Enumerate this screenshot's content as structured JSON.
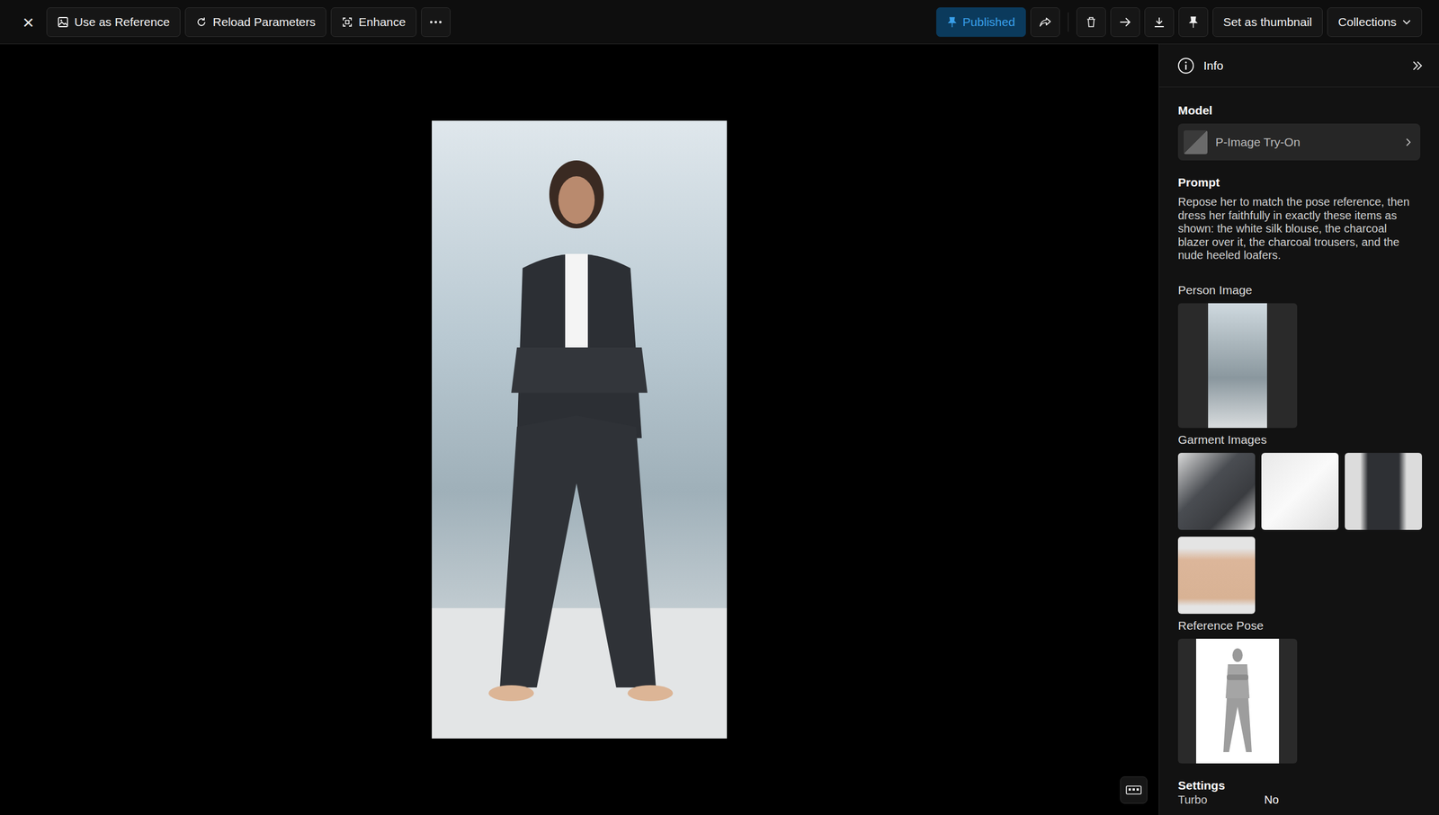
{
  "toolbar": {
    "close": "×",
    "left_buttons": [
      {
        "label": "Use as Reference"
      },
      {
        "label": "Reload Parameters"
      },
      {
        "label": "Enhance"
      }
    ],
    "published": {
      "label": "Published",
      "active": true
    },
    "thumbnail_button": "Set as thumbnail",
    "collections_button": "Collections"
  },
  "info": {
    "title": "Info",
    "model_label": "Model",
    "model": "P-Image Try-On",
    "prompt_label": "Prompt",
    "prompt": "Repose her to match the pose reference, then dress her faithfully in exactly these items as shown: the white silk blouse, the charcoal blazer over it, the charcoal trousers, and the nude heeled loafers.",
    "person_label": "Person Image",
    "garments_label": "Garment Images",
    "pose_label": "Reference Pose",
    "settings_label": "Settings",
    "settings": [
      {
        "label": "Turbo",
        "value": "No"
      }
    ]
  }
}
